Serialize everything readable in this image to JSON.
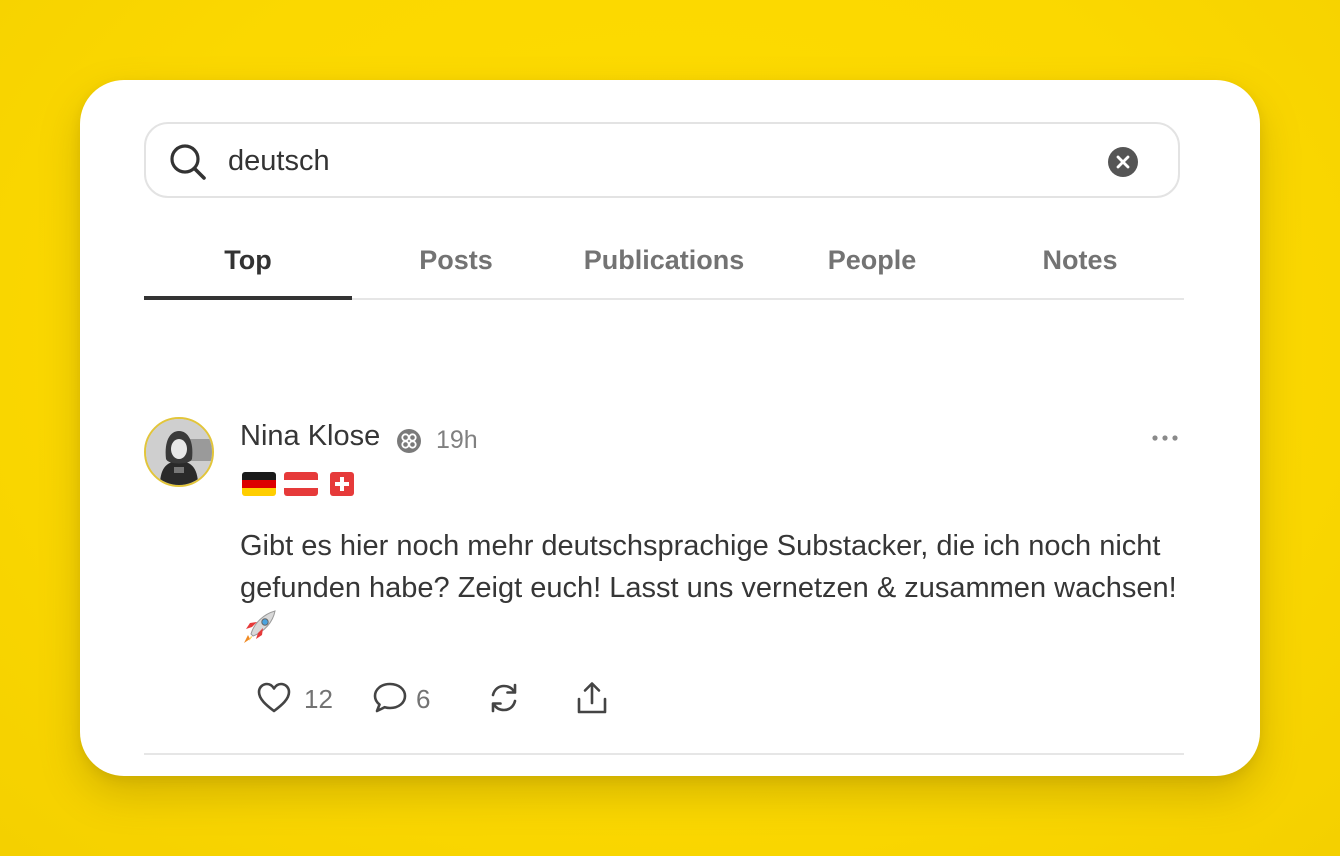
{
  "search": {
    "value": "deutsch",
    "icon": "search-icon",
    "clear_icon": "close-icon"
  },
  "tabs": [
    {
      "label": "Top",
      "active": true
    },
    {
      "label": "Posts",
      "active": false
    },
    {
      "label": "Publications",
      "active": false
    },
    {
      "label": "People",
      "active": false
    },
    {
      "label": "Notes",
      "active": false
    }
  ],
  "note": {
    "author": "Nina Klose",
    "time": "19h",
    "flags": [
      "germany-flag",
      "austria-flag",
      "switzerland-flag"
    ],
    "text": "Gibt es hier noch mehr deutschsprachige Substacker, die ich noch nicht gefunden habe? Zeigt euch! Lasst uns vernetzen & zusammen wachsen!",
    "likes": "12",
    "comments": "6"
  },
  "colors": {
    "background": "#ffd900",
    "card": "#ffffff",
    "text": "#363636",
    "muted": "#737373",
    "avatar_ring": "#e2c53a"
  }
}
